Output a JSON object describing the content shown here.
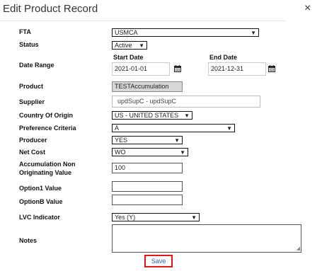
{
  "dialog": {
    "title": "Edit Product Record",
    "close_glyph": "×"
  },
  "fields": {
    "fta": {
      "label": "FTA",
      "value": "USMCA"
    },
    "status": {
      "label": "Status",
      "value": "Active"
    },
    "date_range": {
      "label": "Date Range",
      "start_label": "Start Date",
      "start_value": "2021-01-01",
      "end_label": "End Date",
      "end_value": "2021-12-31"
    },
    "product": {
      "label": "Product",
      "value": "TESTAccumulation"
    },
    "supplier": {
      "label": "Supplier",
      "value": "updSupC - updSupC"
    },
    "country_of_origin": {
      "label": "Country Of Origin",
      "value": "US - UNITED STATES"
    },
    "preference_criteria": {
      "label": "Preference Criteria",
      "value": "A"
    },
    "producer": {
      "label": "Producer",
      "value": "YES"
    },
    "net_cost": {
      "label": "Net Cost",
      "value": "WO"
    },
    "accumulation": {
      "label_line1": "Accumulation Non",
      "label_line2": "Originating Value",
      "value": "100"
    },
    "option1": {
      "label": "Option1 Value",
      "value": ""
    },
    "optionb": {
      "label": "OptionB Value",
      "value": ""
    },
    "lvc": {
      "label": "LVC Indicator",
      "value": "Yes (Y)"
    },
    "notes": {
      "label": "Notes",
      "value": ""
    }
  },
  "icons": {
    "chevron": "chevron-down-icon",
    "calendar": "calendar-icon",
    "close": "close-icon"
  },
  "actions": {
    "save_label": "Save"
  },
  "colors": {
    "save_text": "#2b5fb6",
    "highlight_border": "#e01818"
  }
}
